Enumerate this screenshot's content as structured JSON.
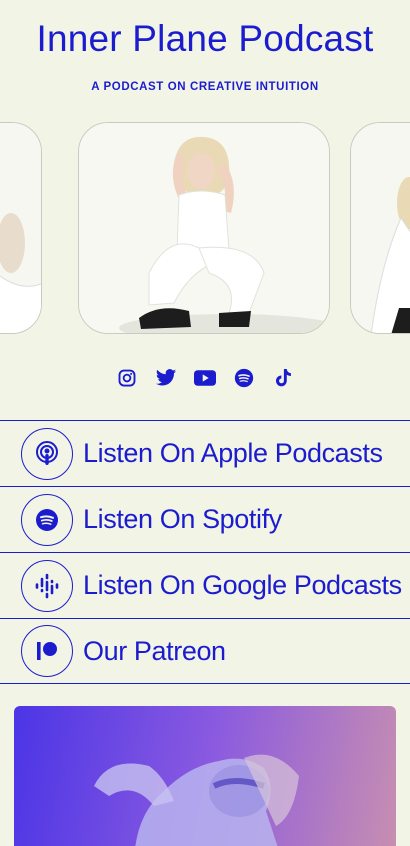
{
  "header": {
    "title": "Inner Plane Podcast",
    "subtitle": "A PODCAST ON CREATIVE INTUITION"
  },
  "carousel": {
    "images": [
      "woman-sitting-white-outfit-left",
      "woman-sitting-white-outfit-center",
      "woman-sitting-white-outfit-right"
    ]
  },
  "socials": [
    {
      "name": "instagram-icon"
    },
    {
      "name": "twitter-icon"
    },
    {
      "name": "youtube-icon"
    },
    {
      "name": "spotify-icon"
    },
    {
      "name": "tiktok-icon"
    }
  ],
  "links": [
    {
      "label": "Listen On Apple Podcasts",
      "icon": "apple-podcasts-icon"
    },
    {
      "label": "Listen On Spotify",
      "icon": "spotify-icon"
    },
    {
      "label": "Listen On Google Podcasts",
      "icon": "google-podcasts-icon"
    },
    {
      "label": "Our Patreon",
      "icon": "patreon-icon"
    }
  ],
  "colors": {
    "background": "#f2f4e6",
    "accent": "#1c1ccf"
  }
}
